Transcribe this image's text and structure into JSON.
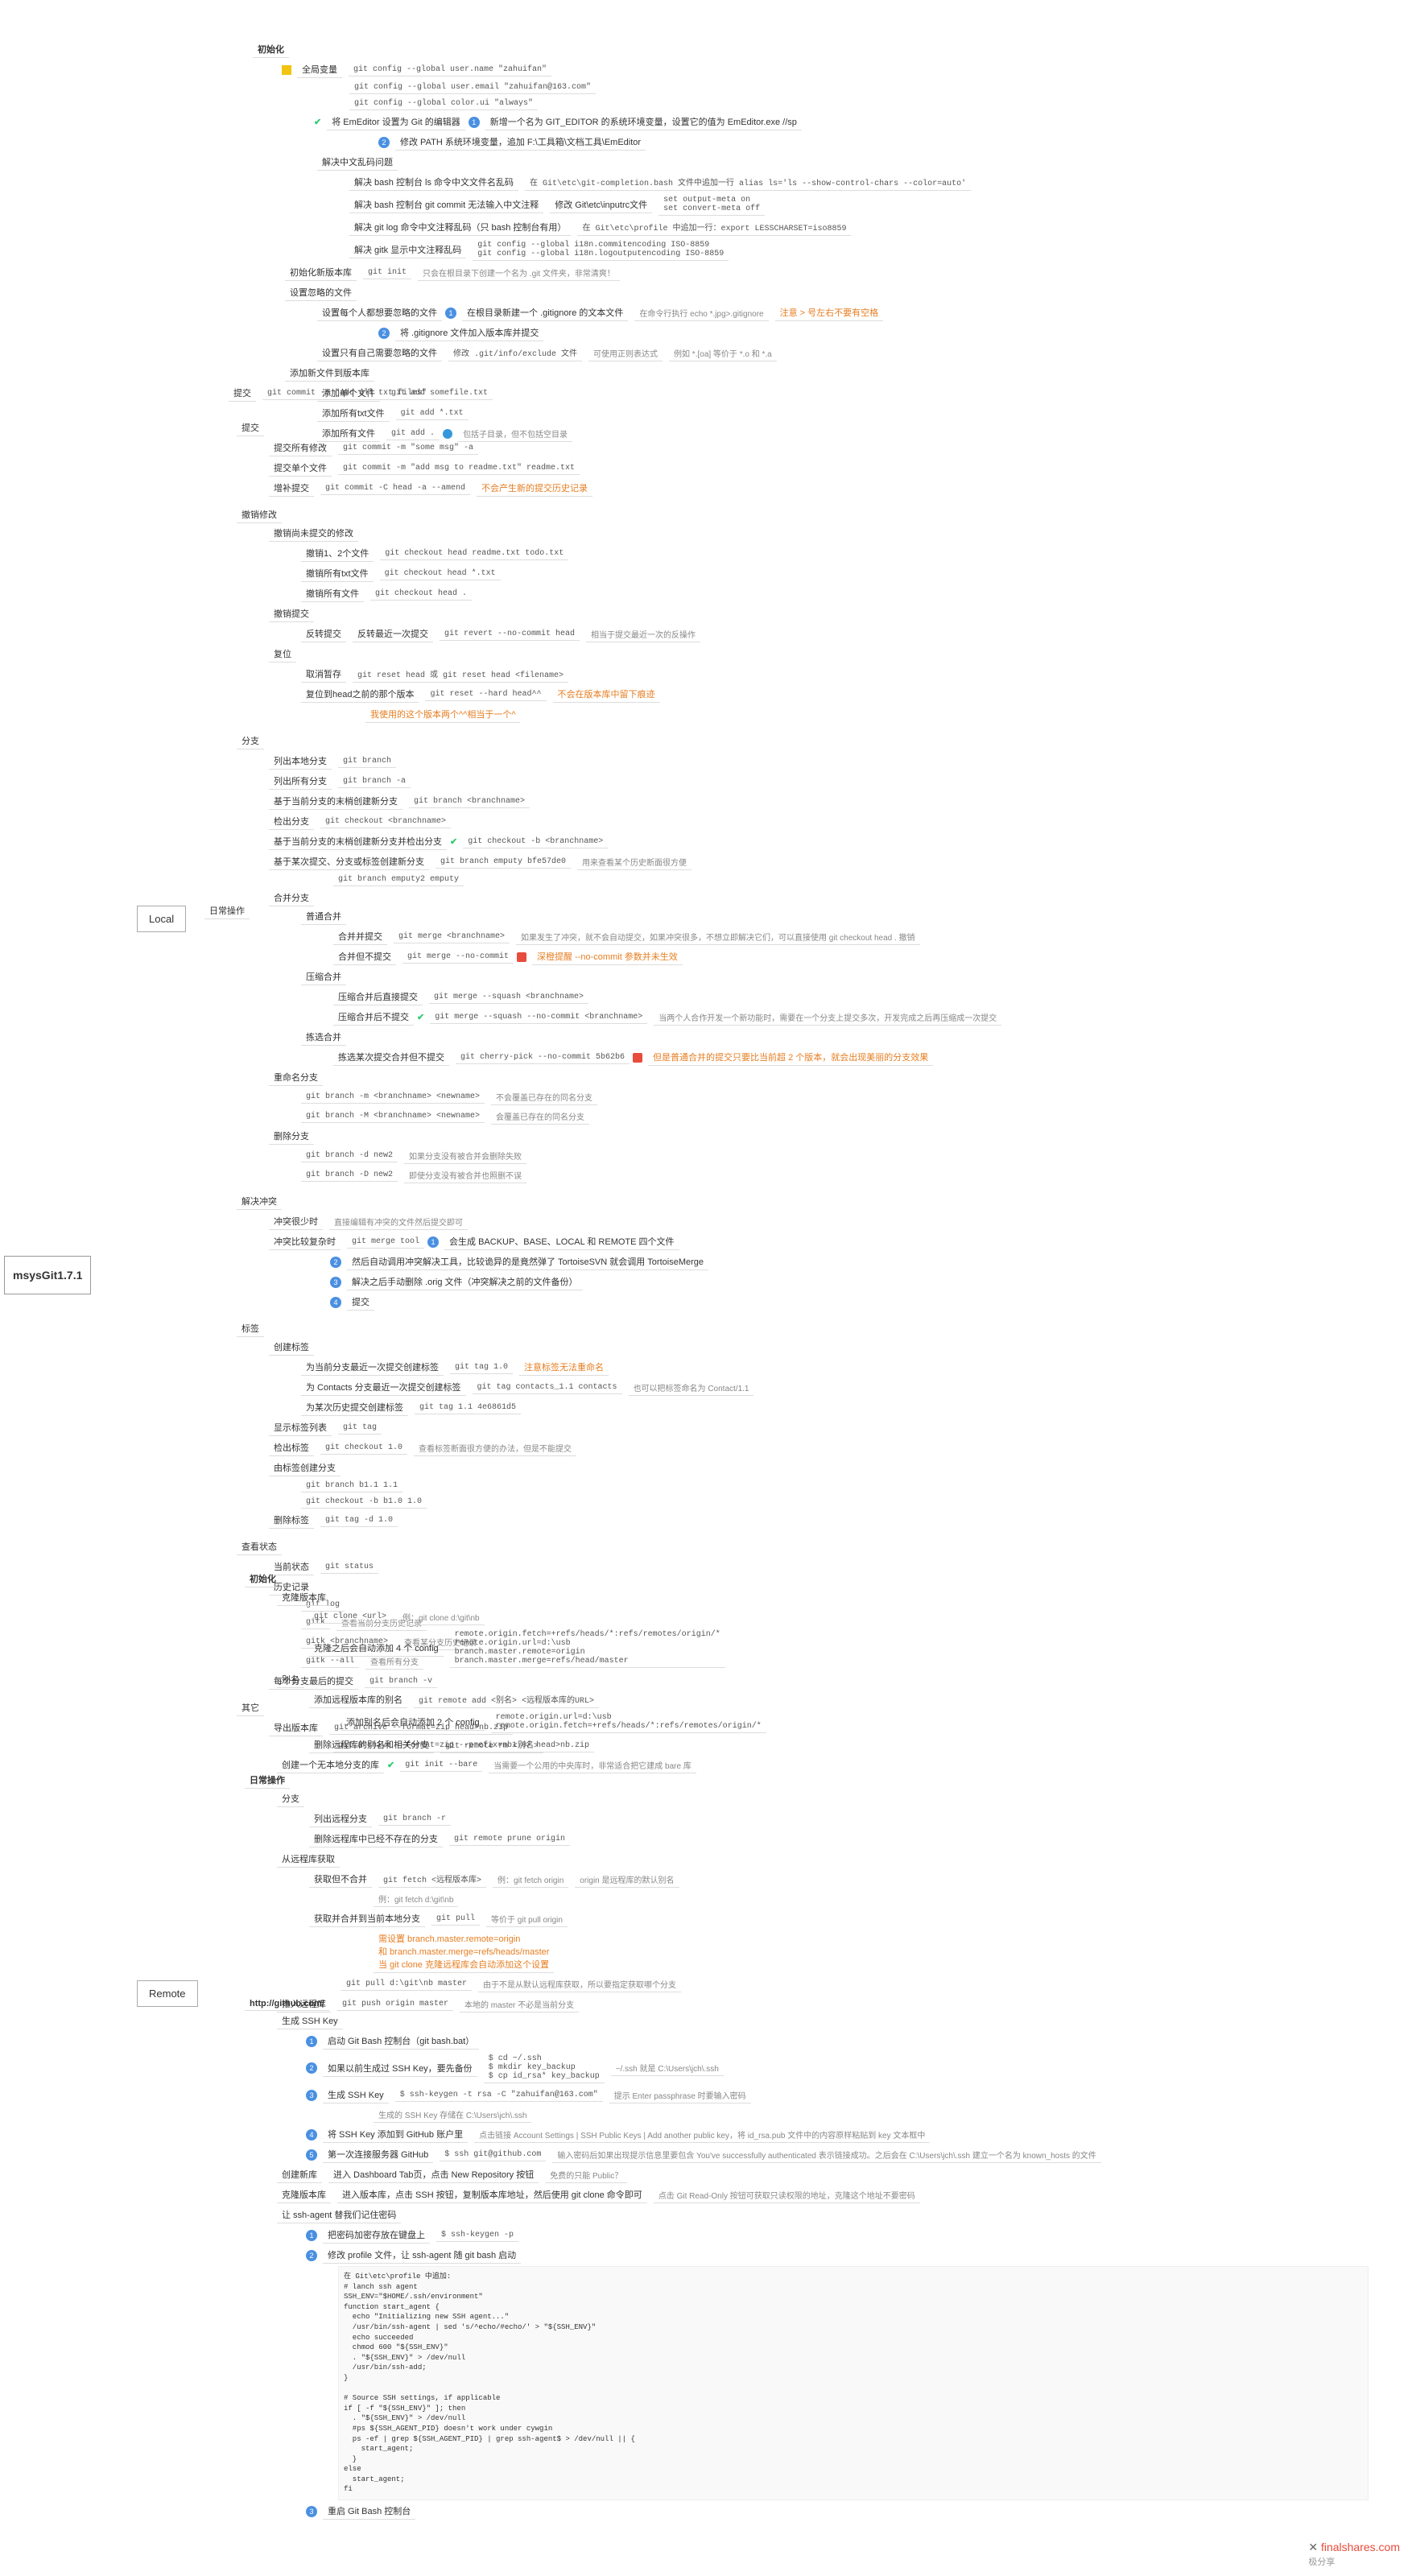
{
  "root": "msysGit1.7.1",
  "footer": {
    "brand": "finalshares.com",
    "sub": "极分享"
  },
  "l1_local": "Local",
  "l1_remote": "Remote",
  "local": {
    "init": {
      "title": "初始化",
      "global": {
        "title": "全局变量",
        "c1": "git config --global user.name \"zahuifan\"",
        "c2": "git config --global user.email \"zahuifan@163.com\"",
        "c3": "git config --global color.ui \"always\"",
        "editor_label": "将 EmEditor 设置为 Git 的编辑器",
        "e1": "新增一个名为 GIT_EDITOR 的系统环境变量，设置它的值为 EmEditor.exe //sp",
        "e2": "修改 PATH 系统环境变量，追加 F:\\工具箱\\文档工具\\EmEditor",
        "cn_title": "解决中文乱码问题",
        "cn1": "解决 bash 控制台 ls 命令中文文件名乱码",
        "cn1b": "在 Git\\etc\\git-completion.bash 文件中追加一行 alias ls='ls --show-control-chars --color=auto'",
        "cn2": "解决 bash 控制台 git commit 无法输入中文注释",
        "cn2a": "修改 Git\\etc\\inputrc文件",
        "cn2b": "set output-meta on\nset convert-meta off",
        "cn3": "解决 git log 命令中文注释乱码（只 bash 控制台有用）",
        "cn3a": "在 Git\\etc\\profile 中追加一行：export LESSCHARSET=iso8859",
        "cn4": "解决 gitk 显示中文注释乱码",
        "cn4a": "git config --global i18n.commitencoding ISO-8859\ngit config --global i18n.logoutputencoding ISO-8859"
      },
      "newrepo": {
        "t": "初始化新版本库",
        "c": "git init",
        "n": "只会在根目录下创建一个名为 .git 文件夹，非常清爽！"
      },
      "ignore": {
        "t": "设置忽略的文件",
        "a": "设置每个人都想要忽略的文件",
        "a1": "在根目录新建一个 .gitignore 的文本文件",
        "a1n": "在命令行执行 echo *.jpg>.gitignore",
        "a1n2": "注意 > 号左右不要有空格",
        "a2": "将 .gitignore 文件加入版本库并提交",
        "b": "设置只有自己需要忽略的文件",
        "b1": "修改 .git/info/exclude 文件",
        "b1n": "可使用正则表达式",
        "b1e": "例如 *.[oa] 等价于 *.o 和 *.a"
      },
      "add": {
        "t": "添加新文件到版本库",
        "a": "添加单个文件",
        "ac": "git add somefile.txt",
        "b": "添加所有txt文件",
        "bc": "git add *.txt",
        "c": "添加所有文件",
        "cc": "git add .",
        "cn": "包括子目录，但不包括空目录"
      }
    },
    "commit": {
      "t": "提交",
      "c": "git commit -m \"add all txt files\""
    },
    "daily": {
      "t": "日常操作",
      "commit": {
        "t": "提交",
        "a": "提交所有修改",
        "ac": "git commit -m \"some msg\" -a",
        "b": "提交单个文件",
        "bc": "git commit -m \"add msg to readme.txt\" readme.txt",
        "c": "增补提交",
        "cc": "git commit -C head -a --amend",
        "cn": "不会产生新的提交历史记录"
      },
      "undo": {
        "t": "撤销修改",
        "a": "撤销尚未提交的修改",
        "a1": "撤销1、2个文件",
        "a1c": "git checkout head readme.txt todo.txt",
        "a2": "撤销所有txt文件",
        "a2c": "git checkout head *.txt",
        "a3": "撤销所有文件",
        "a3c": "git checkout head .",
        "b": "撤销提交",
        "b1": "反转提交",
        "b1a": "反转最近一次提交",
        "b1ac": "git revert --no-commit head",
        "b1an": "相当于提交最近一次的反操作",
        "c": "复位",
        "c1": "取消暂存",
        "c1c": "git reset head 或 git reset head <filename>",
        "c2": "复位到head之前的那个版本",
        "c2c": "git reset --hard head^^",
        "c2n": "不会在版本库中留下痕迹",
        "c2n2": "我使用的这个版本两个^^相当于一个^"
      },
      "branch": {
        "t": "分支",
        "list": "列出本地分支",
        "listc": "git branch",
        "lista": "列出所有分支",
        "listac": "git branch -a",
        "new": "基于当前分支的末梢创建新分支",
        "newc": "git branch <branchname>",
        "co": "检出分支",
        "coc": "git checkout <branchname>",
        "newco": "基于当前分支的末梢创建新分支并检出分支",
        "newcoc": "git checkout -b <branchname>",
        "base": "基于某次提交、分支或标签创建新分支",
        "basec1": "git branch emputy bfe57de0",
        "basen": "用来查看某个历史断面很方便",
        "basec2": "git branch emputy2 emputy",
        "merge": {
          "t": "合并分支",
          "a": "普通合并",
          "a1": "合并并提交",
          "a1c": "git merge <branchname>",
          "a1n": "如果发生了冲突，就不会自动提交，如果冲突很多，不想立即解决它们，可以直接使用 git checkout head . 撤销",
          "a2": "合并但不提交",
          "a2c": "git merge --no-commit",
          "a2n": "深橙提醒 --no-commit 参数并未生效",
          "b": "压缩合并",
          "b1": "压缩合并后直接提交",
          "b1c": "git merge --squash <branchname>",
          "b2": "压缩合并后不提交",
          "b2c": "git merge --squash --no-commit <branchname>",
          "b2n": "当两个人合作开发一个新功能时，需要在一个分支上提交多次，开发完成之后再压缩成一次提交",
          "c": "拣选合并",
          "c1": "拣选某次提交合并但不提交",
          "c1c": "git cherry-pick --no-commit 5b62b6",
          "c1n": "但是普通合并的提交只要比当前超 2 个版本，就会出现美丽的分支效果"
        },
        "rename": {
          "t": "重命名分支",
          "a": "git branch -m <branchname> <newname>",
          "an": "不会覆盖已存在的同名分支",
          "b": "git branch -M <branchname> <newname>",
          "bn": "会覆盖已存在的同名分支"
        },
        "del": {
          "t": "删除分支",
          "a": "git branch -d new2",
          "an": "如果分支没有被合并会删除失败",
          "b": "git branch -D new2",
          "bn": "即使分支没有被合并也照删不误"
        }
      },
      "conflict": {
        "t": "解决冲突",
        "a": "冲突很少时",
        "an": "直接编辑有冲突的文件然后提交即可",
        "b": "冲突比较复杂时",
        "bc": "git merge tool",
        "b1": "会生成 BACKUP、BASE、LOCAL 和 REMOTE 四个文件",
        "b2": "然后自动调用冲突解决工具，比较诡异的是竟然弹了 TortoiseSVN 就会调用 TortoiseMerge",
        "b3": "解决之后手动删除 .orig 文件（冲突解决之前的文件备份）",
        "b4": "提交"
      },
      "tag": {
        "t": "标签",
        "create": "创建标签",
        "c1": "为当前分支最近一次提交创建标签",
        "c1c": "git tag 1.0",
        "c1n": "注意标签无法重命名",
        "c2": "为 Contacts 分支最近一次提交创建标签",
        "c2c": "git tag contacts_1.1 contacts",
        "c2n": "也可以把标签命名为 Contact/1.1",
        "c3": "为某次历史提交创建标签",
        "c3c": "git tag 1.1 4e6861d5",
        "list": "显示标签列表",
        "listc": "git tag",
        "co": "检出标签",
        "coc": "git checkout 1.0",
        "con": "查看标签断面很方便的办法，但是不能提交",
        "fromtag": "由标签创建分支",
        "f1": "git branch b1.1 1.1",
        "f2": "git checkout -b b1.0 1.0",
        "del": "删除标签",
        "delc": "git tag -d 1.0"
      },
      "status": {
        "t": "查看状态",
        "a": "当前状态",
        "ac": "git status",
        "b": "历史记录",
        "bc": "git log",
        "b1": "gitk",
        "b1n": "查看当前分支历史记录",
        "b2": "gitk <branchname>",
        "b2n": "查看某分支历史记录",
        "b3": "gitk --all",
        "b3n": "查看所有分支",
        "c": "每个分支最后的提交",
        "cc": "git branch -v"
      },
      "other": {
        "t": "其它",
        "a": "导出版本库",
        "a1": "git archive --format=zip head>nb.zip",
        "a2": "git archive --format=zip --prefix=nb1.0/ head>nb.zip"
      }
    }
  },
  "remote": {
    "init": {
      "t": "初始化",
      "clone": {
        "t": "克隆版本库",
        "c": "git clone <url>",
        "e": "例：git clone d:\\git\\nb",
        "cfg": "克隆之后会自动添加 4 个 config",
        "cfg1": "remote.origin.fetch=+refs/heads/*:refs/remotes/origin/*",
        "cfg2": "remote.origin.url=d:\\usb",
        "cfg3": "branch.master.remote=origin",
        "cfg4": "branch.master.merge=refs/head/master"
      },
      "alias": {
        "t": "别名",
        "a": "添加远程版本库的别名",
        "ac": "git remote add <别名> <远程版本库的URL>",
        "ab": "添加别名后会自动添加 2 个 config",
        "ab1": "remote.origin.url=d:\\usb",
        "ab2": "remote.origin.fetch=+refs/heads/*:refs/remotes/origin/*",
        "b": "删除远程库的别名和相关分支",
        "bc": "git remote rm <别名>"
      },
      "bare": {
        "t": "创建一个无本地分支的库",
        "c": "git init --bare",
        "n": "当需要一个公用的中央库时，非常适合把它建成 bare 库"
      }
    },
    "daily": {
      "t": "日常操作",
      "branch": {
        "t": "分支",
        "a": "列出远程分支",
        "ac": "git branch -r",
        "b": "删除远程库中已经不存在的分支",
        "bc": "git remote prune origin"
      },
      "fetch": {
        "t": "从远程库获取",
        "a": "获取但不合并",
        "ac": "git fetch <远程版本库>",
        "e1": "例：git fetch origin",
        "e1n": "origin 是远程库的默认别名",
        "e2": "例：git fetch d:\\git\\nb",
        "b": "获取并合并到当前本地分支",
        "bc": "git pull",
        "b1": "等价于 git pull origin",
        "b2": "需设置 branch.master.remote=origin\n和 branch.master.merge=refs/heads/master\n当 git clone 克隆远程库会自动添加这个设置",
        "b3": "git pull d:\\git\\nb master",
        "b3n": "由于不是从默认远程库获取，所以要指定获取哪个分支"
      },
      "push": {
        "t": "推入远程库",
        "c": "git push origin master",
        "n": "本地的 master 不必是当前分支"
      }
    },
    "github": {
      "t": "http://github.com/",
      "ssh": {
        "t": "生成 SSH Key",
        "s1": "启动 Git Bash 控制台（git bash.bat）",
        "s2": "如果以前生成过 SSH Key，要先备份",
        "s2c": "$ cd ~/.ssh\n$ mkdir key_backup\n$ cp id_rsa* key_backup",
        "s2n": "~/.ssh 就是 C:\\Users\\jch\\.ssh",
        "s3": "生成 SSH Key",
        "s3c": "$ ssh-keygen -t rsa -C \"zahuifan@163.com\"",
        "s3n1": "提示 Enter passphrase 时要输入密码",
        "s3n2": "生成的 SSH Key 存储在 C:\\Users\\jch\\.ssh",
        "s4": "将 SSH Key 添加到 GitHub 账户里",
        "s4n": "点击链接 Account Settings | SSH Public Keys | Add another public key，将 id_rsa.pub 文件中的内容原样粘贴到 key 文本框中",
        "s5": "第一次连接服务器 GitHub",
        "s5c": "$ ssh git@github.com",
        "s5n": "输入密码后如果出现提示信息里要包含 You've successfully authenticated 表示链接成功。之后会在 C:\\Users\\jch\\.ssh 建立一个名为 known_hosts 的文件"
      },
      "newrepo": {
        "t": "创建新库",
        "n": "进入 Dashboard Tab页，点击 New Repository 按钮",
        "n2": "免费的只能 Public？"
      },
      "cl": {
        "t": "克隆版本库",
        "n": "进入版本库，点击 SSH 按钮，复制版本库地址，然后使用 git clone 命令即可",
        "n2": "点击 Git Read-Only 按钮可获取只读权限的地址，克隆这个地址不要密码"
      },
      "agent": {
        "t": "让 ssh-agent 替我们记住密码",
        "s1": "把密码加密存放在键盘上",
        "s1c": "$ ssh-keygen -p",
        "s2": "修改 profile 文件，让 ssh-agent 随 git bash 启动",
        "code": "在 Git\\etc\\profile 中追加:\n# lanch ssh agent\nSSH_ENV=\"$HOME/.ssh/environment\"\nfunction start_agent {\n  echo \"Initializing new SSH agent...\"\n  /usr/bin/ssh-agent | sed 's/^echo/#echo/' > \"${SSH_ENV}\"\n  echo succeeded\n  chmod 600 \"${SSH_ENV}\"\n  . \"${SSH_ENV}\" > /dev/null\n  /usr/bin/ssh-add;\n}\n\n# Source SSH settings, if applicable\nif [ -f \"${SSH_ENV}\" ]; then\n  . \"${SSH_ENV}\" > /dev/null\n  #ps ${SSH_AGENT_PID} doesn't work under cywgin\n  ps -ef | grep ${SSH_AGENT_PID} | grep ssh-agent$ > /dev/null || {\n    start_agent;\n  }\nelse\n  start_agent;\nfi",
        "s3": "重启 Git Bash 控制台"
      }
    }
  }
}
